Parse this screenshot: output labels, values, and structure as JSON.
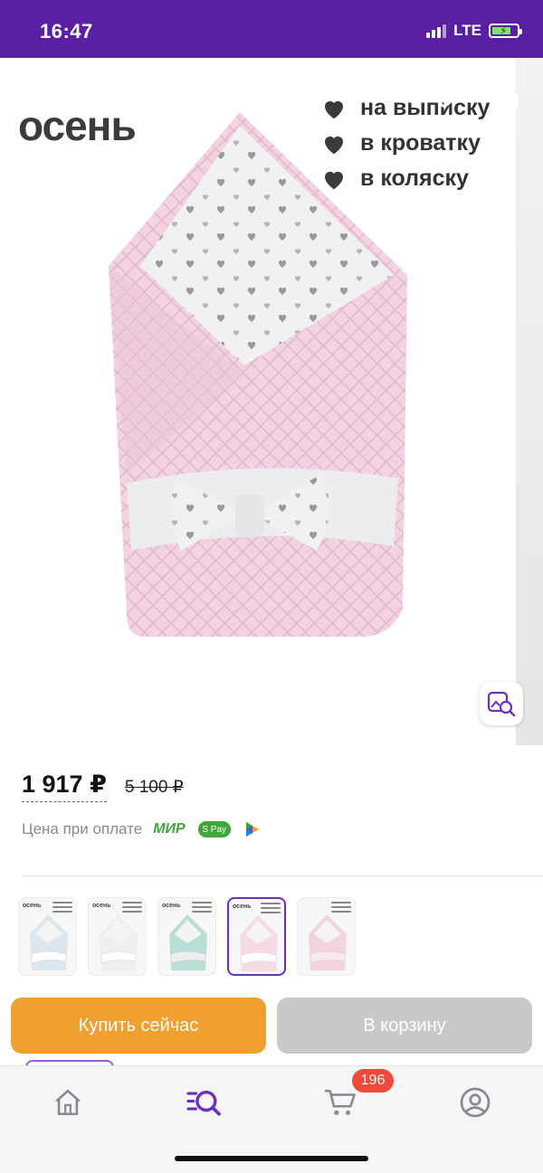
{
  "status_bar": {
    "time": "16:47",
    "network": "LTE",
    "battery_level": 0.75
  },
  "gallery": {
    "brand": "осень",
    "features": [
      "на выписку",
      "в кроватку",
      "в коляску"
    ]
  },
  "price": {
    "current": "1 917 ₽",
    "old": "5 100 ₽",
    "pay_label": "Цена при оплате",
    "mir_label": "МИР",
    "spay_label": "S Pay"
  },
  "thumbnails": [
    {
      "brand": "осень",
      "color": "#dbe6ee",
      "bow": "#ffffff"
    },
    {
      "brand": "осень",
      "color": "#efefef",
      "bow": "#ffffff"
    },
    {
      "brand": "осень",
      "color": "#b9ded8",
      "bow": "#eeeeee"
    },
    {
      "brand": "осень",
      "color": "#f4dbe6",
      "bow": "#ffffff",
      "selected": true
    },
    {
      "brand": "",
      "color": "#f3d4de",
      "bow": "#f7e9ef"
    }
  ],
  "actions": {
    "buy_now": "Купить сейчас",
    "add_to_cart": "В корзину"
  },
  "tab_bar": {
    "cart_badge": "196"
  },
  "colors": {
    "accent": "#5b1fa4",
    "buy": "#f0a030",
    "cart": "#c9c9cc",
    "badge": "#ef4a3a"
  }
}
